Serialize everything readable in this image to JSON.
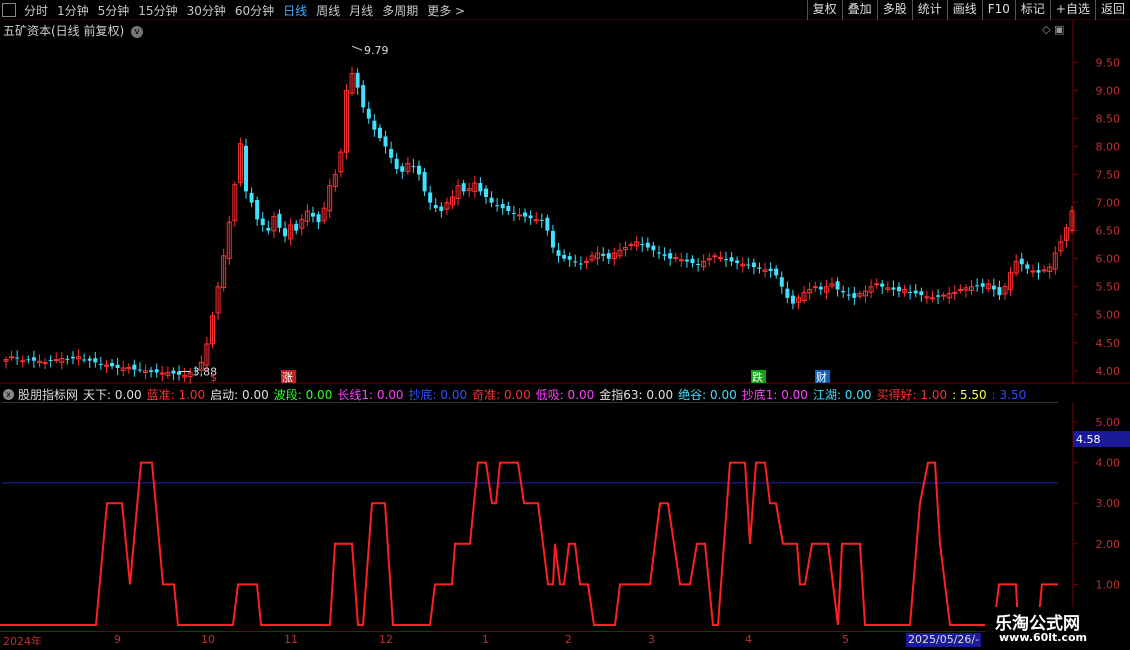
{
  "toolbar": {
    "periods": [
      "分时",
      "1分钟",
      "5分钟",
      "15分钟",
      "30分钟",
      "60分钟",
      "日线",
      "周线",
      "月线",
      "多周期",
      "更多 >"
    ],
    "active_period": "日线",
    "right_buttons": [
      "复权",
      "叠加",
      "多股",
      "统计",
      "画线",
      "F10",
      "标记",
      "+自选",
      "返回"
    ]
  },
  "main": {
    "stock_title": "五矿资本(日线 前复权)",
    "high_label": "9.79",
    "low_label": "3.88",
    "y_ticks": [
      "9.50",
      "9.00",
      "8.50",
      "8.00",
      "7.50",
      "7.00",
      "6.50",
      "6.00",
      "5.50",
      "5.00",
      "4.50",
      "4.00"
    ],
    "markers": [
      "$",
      "涨",
      "跌",
      "财"
    ]
  },
  "indicator": {
    "name": "股朋指标网",
    "items": [
      {
        "label": "天下: 0.00",
        "color": "#e0e0e0"
      },
      {
        "label": "蓝准: 1.00",
        "color": "#ff3030"
      },
      {
        "label": "启动: 0.00",
        "color": "#e0e0e0"
      },
      {
        "label": "波段: 0.00",
        "color": "#30ff30"
      },
      {
        "label": "长线1: 0.00",
        "color": "#ff40ff"
      },
      {
        "label": "抄底: 0.00",
        "color": "#3050ff"
      },
      {
        "label": "奇准: 0.00",
        "color": "#ff3030"
      },
      {
        "label": "低吸: 0.00",
        "color": "#ff40ff"
      },
      {
        "label": "金指63: 0.00",
        "color": "#e0e0e0"
      },
      {
        "label": "绝谷: 0.00",
        "color": "#40e0ff"
      },
      {
        "label": "抄底1: 0.00",
        "color": "#ff40ff"
      },
      {
        "label": "江湖: 0.00",
        "color": "#40e0ff"
      },
      {
        "label": "买得好: 1.00",
        "color": "#ff3030"
      },
      {
        "label": ": 5.50",
        "color": "#ffff40"
      },
      {
        "label": ": 3.50",
        "color": "#3050ff"
      }
    ],
    "y_ticks": [
      "5.00",
      "4.00",
      "3.00",
      "2.00",
      "1.00"
    ],
    "current_value": "4.58",
    "level_high": 5.5,
    "level_mid": 3.5
  },
  "date_axis": {
    "labels": [
      "2024年",
      "9",
      "10",
      "11",
      "12",
      "1",
      "2",
      "3",
      "4",
      "5"
    ],
    "current_date": "2025/05/26/-"
  },
  "watermark": {
    "title": "乐淘公式网",
    "url": "www.60lt.com"
  },
  "colors": {
    "up": "#ff3030",
    "down": "#40e0ff",
    "signal_line": "#ff2020",
    "grid": "#7a0000",
    "axis_text": "#c03030",
    "level_mid": "#2020c0",
    "level_high": "#d0d0d0"
  },
  "chart_data": [
    {
      "type": "candlestick",
      "title": "五矿资本(日线 前复权)",
      "ylim": [
        3.8,
        9.9
      ],
      "annotations": [
        {
          "label": "high",
          "value": 9.79
        },
        {
          "label": "low",
          "value": 3.88
        }
      ],
      "close_series": [
        4.2,
        4.25,
        4.22,
        4.18,
        4.2,
        4.18,
        4.17,
        4.15,
        4.18,
        4.2,
        4.22,
        4.2,
        4.22,
        4.25,
        4.2,
        4.18,
        4.15,
        4.12,
        4.1,
        4.08,
        4.05,
        4.05,
        4.06,
        4.02,
        4.02,
        4.0,
        3.98,
        3.97,
        3.96,
        3.97,
        3.95,
        3.93,
        3.92,
        3.96,
        4.0,
        4.15,
        4.48,
        4.98,
        5.5,
        6.05,
        6.65,
        7.32,
        8.05,
        7.2,
        7.0,
        6.7,
        6.6,
        6.5,
        6.75,
        6.55,
        6.4,
        6.6,
        6.5,
        6.7,
        6.85,
        6.75,
        6.65,
        6.9,
        7.3,
        7.5,
        7.9,
        9.0,
        9.3,
        9.05,
        8.7,
        8.5,
        8.3,
        8.15,
        8.0,
        7.8,
        7.6,
        7.55,
        7.7,
        7.65,
        7.5,
        7.2,
        7.0,
        6.9,
        6.85,
        7.0,
        7.1,
        7.3,
        7.2,
        7.25,
        7.35,
        7.2,
        7.1,
        7.0,
        6.95,
        6.9,
        6.85,
        6.8,
        6.78,
        6.75,
        6.72,
        6.7,
        6.68,
        6.5,
        6.2,
        6.05,
        6.0,
        5.98,
        5.95,
        5.9,
        5.95,
        6.05,
        6.1,
        6.05,
        6.0,
        6.1,
        6.15,
        6.2,
        6.25,
        6.3,
        6.25,
        6.2,
        6.15,
        6.1,
        6.05,
        6.0,
        6.02,
        5.98,
        5.95,
        5.92,
        5.9,
        5.95,
        6.0,
        6.05,
        6.02,
        5.98,
        5.95,
        5.92,
        5.9,
        5.88,
        5.85,
        5.82,
        5.8,
        5.78,
        5.7,
        5.5,
        5.3,
        5.2,
        5.3,
        5.4,
        5.45,
        5.5,
        5.45,
        5.5,
        5.55,
        5.45,
        5.4,
        5.35,
        5.3,
        5.38,
        5.42,
        5.5,
        5.55,
        5.5,
        5.48,
        5.45,
        5.42,
        5.45,
        5.4,
        5.38,
        5.35,
        5.32,
        5.3,
        5.32,
        5.35,
        5.38,
        5.4,
        5.45,
        5.48,
        5.5,
        5.52,
        5.5,
        5.55,
        5.45,
        5.35,
        5.5,
        5.75,
        5.95,
        5.9,
        5.82,
        5.78,
        5.75,
        5.8,
        5.85,
        6.1,
        6.3,
        6.55,
        6.85
      ]
    },
    {
      "type": "line",
      "title": "股朋指标网",
      "ylim": [
        0,
        5.5
      ],
      "reference_lines": [
        5.5,
        3.5
      ],
      "series": [
        {
          "name": "signal",
          "points": [
            [
              0.0,
              0
            ],
            [
              96.0,
              0
            ],
            [
              107.0,
              3
            ],
            [
              122.0,
              3
            ],
            [
              130.0,
              1
            ],
            [
              141.0,
              4
            ],
            [
              152.0,
              4
            ],
            [
              163.0,
              1
            ],
            [
              174.0,
              1
            ],
            [
              178.0,
              0
            ],
            [
              233.0,
              0
            ],
            [
              238.0,
              1
            ],
            [
              257.0,
              1
            ],
            [
              261.0,
              0
            ],
            [
              330.0,
              0
            ],
            [
              335.0,
              2
            ],
            [
              352.0,
              2
            ],
            [
              358.0,
              0
            ],
            [
              363.0,
              0
            ],
            [
              372.0,
              3
            ],
            [
              385.0,
              3
            ],
            [
              393.0,
              0
            ],
            [
              430.0,
              0
            ],
            [
              435.0,
              1
            ],
            [
              452.0,
              1
            ],
            [
              455.0,
              2
            ],
            [
              470.0,
              2
            ],
            [
              478.0,
              4
            ],
            [
              486.0,
              4
            ],
            [
              492.0,
              3
            ],
            [
              496.0,
              3
            ],
            [
              500.0,
              4
            ],
            [
              518.0,
              4
            ],
            [
              524.0,
              3
            ],
            [
              538.0,
              3
            ],
            [
              548.0,
              1
            ],
            [
              553.0,
              1
            ],
            [
              555.0,
              2
            ],
            [
              560.0,
              1
            ],
            [
              564.0,
              1
            ],
            [
              569.0,
              2
            ],
            [
              575.0,
              2
            ],
            [
              580.0,
              1
            ],
            [
              588.0,
              1
            ],
            [
              594.0,
              0
            ],
            [
              615.0,
              0
            ],
            [
              620.0,
              1
            ],
            [
              650.0,
              1
            ],
            [
              655.0,
              2
            ],
            [
              660.0,
              3
            ],
            [
              668.0,
              3
            ],
            [
              680.0,
              1
            ],
            [
              690.0,
              1
            ],
            [
              697.0,
              2
            ],
            [
              705.0,
              2
            ],
            [
              713.0,
              0
            ],
            [
              718.0,
              0
            ],
            [
              730.0,
              4
            ],
            [
              745.0,
              4
            ],
            [
              750.0,
              2
            ],
            [
              756.0,
              4
            ],
            [
              765.0,
              4
            ],
            [
              770.0,
              3
            ],
            [
              776.0,
              3
            ],
            [
              783.0,
              2
            ],
            [
              797.0,
              2
            ],
            [
              800.0,
              1
            ],
            [
              805.0,
              1
            ],
            [
              812.0,
              2
            ],
            [
              828.0,
              2
            ],
            [
              838.0,
              0
            ],
            [
              842.0,
              2
            ],
            [
              860.0,
              2
            ],
            [
              865.0,
              0
            ],
            [
              910.0,
              0
            ],
            [
              920.0,
              3
            ],
            [
              928.0,
              4
            ],
            [
              935.0,
              4
            ],
            [
              940.0,
              2
            ],
            [
              950.0,
              0
            ],
            [
              994.0,
              0
            ],
            [
              999.0,
              1
            ],
            [
              1016.0,
              1
            ],
            [
              1018.0,
              0
            ],
            [
              1038.0,
              0
            ],
            [
              1042.0,
              1
            ],
            [
              1058.0,
              1
            ]
          ]
        }
      ]
    }
  ]
}
